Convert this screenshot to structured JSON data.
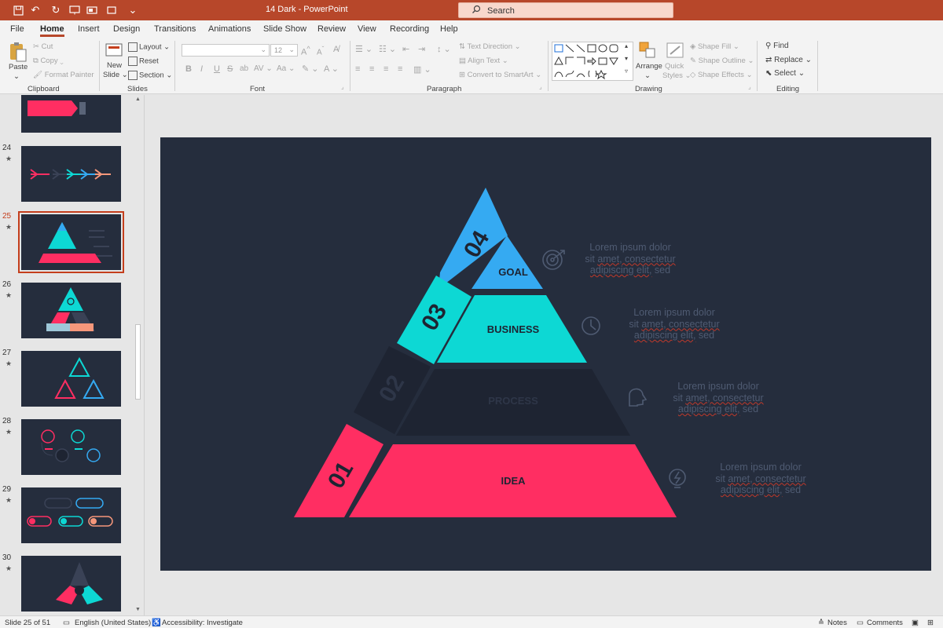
{
  "titlebar": {
    "doc_title": "14 Dark  -  PowerPoint",
    "search_placeholder": "Search",
    "colors": {
      "bar": "#b7472a"
    }
  },
  "menu": {
    "tabs": [
      "File",
      "Home",
      "Insert",
      "Design",
      "Transitions",
      "Animations",
      "Slide Show",
      "Review",
      "View",
      "Recording",
      "Help"
    ],
    "active": "Home"
  },
  "ribbon": {
    "clipboard": {
      "label": "Clipboard",
      "paste": "Paste",
      "cut": "Cut",
      "copy": "Copy",
      "format_painter": "Format Painter"
    },
    "slides": {
      "label": "Slides",
      "new_slide_1": "New",
      "new_slide_2": "Slide",
      "layout": "Layout",
      "reset": "Reset",
      "section": "Section"
    },
    "font": {
      "label": "Font",
      "size": "12"
    },
    "paragraph": {
      "label": "Paragraph",
      "text_direction": "Text Direction",
      "align_text": "Align Text",
      "convert_smartart": "Convert to SmartArt"
    },
    "drawing": {
      "label": "Drawing",
      "arrange": "Arrange",
      "quick_styles_1": "Quick",
      "quick_styles_2": "Styles",
      "shape_fill": "Shape Fill",
      "shape_outline": "Shape Outline",
      "shape_effects": "Shape Effects"
    },
    "editing": {
      "label": "Editing",
      "find": "Find",
      "replace": "Replace",
      "select": "Select"
    }
  },
  "slide_panel": {
    "slides": [
      {
        "num": "24"
      },
      {
        "num": "25",
        "selected": true
      },
      {
        "num": "26"
      },
      {
        "num": "27"
      },
      {
        "num": "28"
      },
      {
        "num": "29"
      },
      {
        "num": "30"
      }
    ]
  },
  "slide": {
    "colors": {
      "background": "#252d3d",
      "blue": "#35aaf2",
      "cyan": "#0dd8d4",
      "dark": "#1e2432",
      "pink": "#ff2e62",
      "muted": "#4f5b72"
    },
    "levels": [
      {
        "num": "04",
        "label": "GOAL",
        "icon": "target-icon"
      },
      {
        "num": "03",
        "label": "BUSINESS",
        "icon": "clock-icon"
      },
      {
        "num": "02",
        "label": "PROCESS",
        "icon": "head-icon"
      },
      {
        "num": "01",
        "label": "IDEA",
        "icon": "lightbulb-icon"
      }
    ],
    "lorem": {
      "line1": "Lorem ipsum dolor",
      "line2_a": "sit ",
      "line2_b": "amet, consectetur",
      "line3_a": "adipiscing elit,",
      "line3_b": " sed"
    }
  },
  "status": {
    "slide_of": "Slide 25 of 51",
    "language": "English (United States)",
    "accessibility": "Accessibility: Investigate",
    "notes": "Notes",
    "comments": "Comments"
  }
}
